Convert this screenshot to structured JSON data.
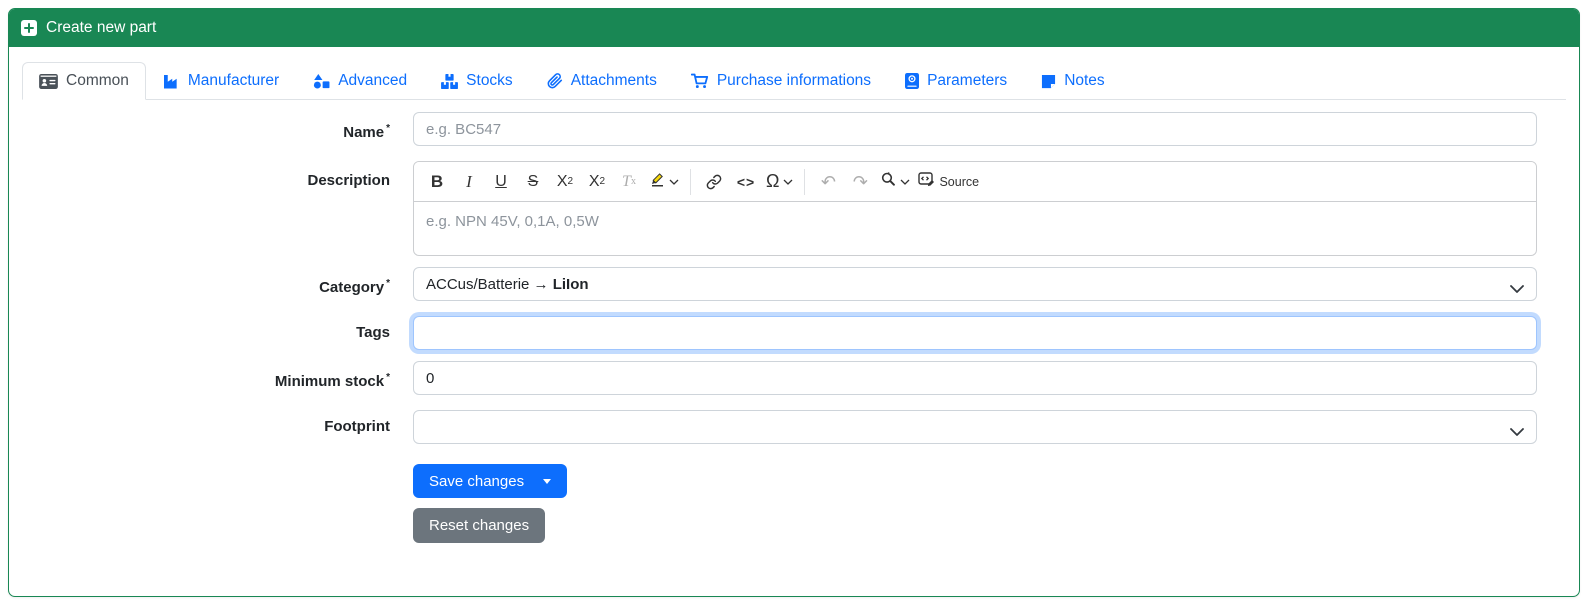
{
  "card": {
    "title": "Create new part"
  },
  "tabs": [
    {
      "label": "Common",
      "active": true
    },
    {
      "label": "Manufacturer"
    },
    {
      "label": "Advanced"
    },
    {
      "label": "Stocks"
    },
    {
      "label": "Attachments"
    },
    {
      "label": "Purchase informations"
    },
    {
      "label": "Parameters"
    },
    {
      "label": "Notes"
    }
  ],
  "form": {
    "name": {
      "label": "Name",
      "required_marker": "*",
      "placeholder": "e.g. BC547",
      "value": ""
    },
    "description": {
      "label": "Description",
      "placeholder": "e.g. NPN 45V, 0,1A, 0,5W",
      "value": "",
      "toolbar": {
        "bold": "B",
        "italic": "I",
        "underline": "U",
        "strikethrough": "S",
        "subscript_x": "X",
        "subscript_2": "2",
        "superscript_x": "X",
        "superscript_2": "2",
        "remove_format_t": "T",
        "remove_format_x": "x",
        "code": "<>",
        "special_characters": "Ω",
        "undo": "↶",
        "redo": "↷",
        "source": "Source"
      }
    },
    "category": {
      "label": "Category",
      "required_marker": "*",
      "value_path": "ACCus/Batterie → ",
      "value_selected": "LiIon"
    },
    "tags": {
      "label": "Tags",
      "value": ""
    },
    "minimum_stock": {
      "label": "Minimum stock",
      "required_marker": "*",
      "value": "0"
    },
    "footprint": {
      "label": "Footprint",
      "value": ""
    }
  },
  "actions": {
    "save": "Save changes",
    "reset": "Reset changes"
  },
  "colors": {
    "header_green": "#198754",
    "tab_blue": "#0d6efd",
    "primary_blue": "#0d6efd",
    "secondary_gray": "#6c757d",
    "focus_ring": "#9ec5fe"
  }
}
